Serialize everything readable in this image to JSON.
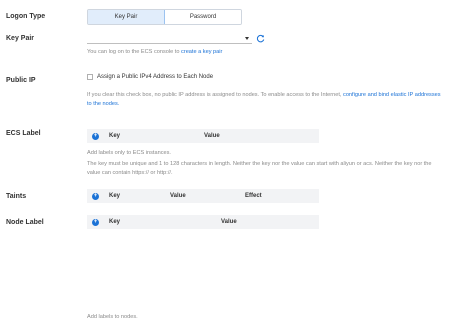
{
  "logon_type": {
    "label": "Logon Type",
    "options": [
      "Key Pair",
      "Password"
    ],
    "selected": "Key Pair"
  },
  "key_pair": {
    "label": "Key Pair",
    "value": "",
    "help_prefix": "You can log on to the ECS console to ",
    "help_link": "create a key pair"
  },
  "public_ip": {
    "label": "Public IP",
    "checkbox_label": "Assign a Public IPv4 Address to Each Node",
    "checked": false,
    "help_line1_prefix": "If you clear this check box, no public IP address is assigned to nodes. To enable access to the Internet, ",
    "help_link_line1": "configure and bind elastic IP addresses",
    "help_link_line2": "to the nodes."
  },
  "ecs_label": {
    "label": "ECS Label",
    "columns": [
      "Key",
      "Value"
    ],
    "help1": "Add labels only to ECS instances.",
    "help2": "The key must be unique and 1 to 128 characters in length. Neither the key nor the value can start with aliyun or acs. Neither the key nor the",
    "help3": "value can contain https:// or http://."
  },
  "taints": {
    "label": "Taints",
    "columns": [
      "Key",
      "Value",
      "Effect"
    ]
  },
  "node_label": {
    "label": "Node Label",
    "columns": [
      "Key",
      "Value"
    ],
    "help": "Add labels to nodes."
  },
  "icons": {
    "add": "+",
    "refresh": "refresh-icon",
    "dropdown": "chevron-down-icon"
  },
  "colors": {
    "accent": "#1b72d6",
    "segment_active_bg": "#e1edfb",
    "table_header_bg": "#f2f3f5"
  }
}
